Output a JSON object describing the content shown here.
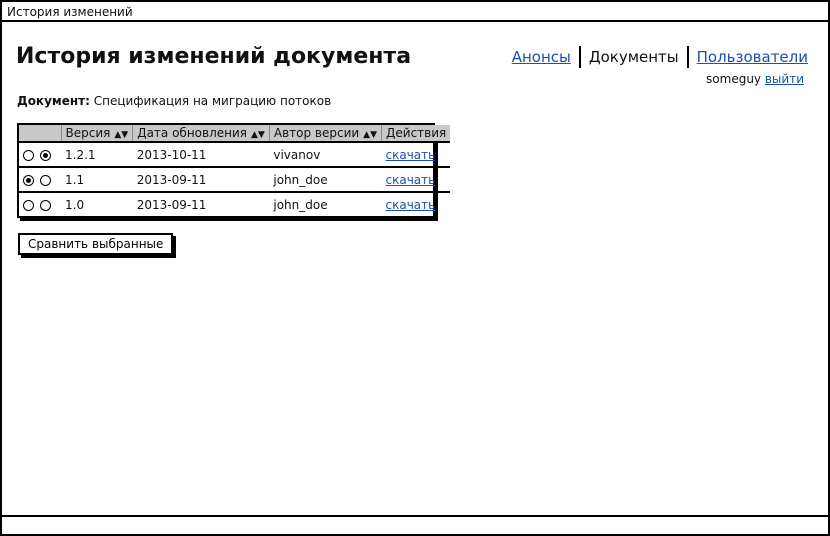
{
  "window": {
    "title": "История изменений"
  },
  "header": {
    "title": "История изменений документа",
    "nav": [
      {
        "label": "Анонсы",
        "current": false
      },
      {
        "label": "Документы",
        "current": true
      },
      {
        "label": "Пользователи",
        "current": false
      }
    ],
    "user": {
      "name": "someguy",
      "logout_label": "выйти"
    }
  },
  "document": {
    "label": "Документ:",
    "name": "Спецификация на миграцию потоков"
  },
  "table": {
    "columns": [
      "Версия",
      "Дата обновления",
      "Автор версии",
      "Действия"
    ],
    "rows": [
      {
        "version": "1.2.1",
        "date": "2013-10-11",
        "author": "vivanov",
        "action": "скачать",
        "radio_a": false,
        "radio_b": true
      },
      {
        "version": "1.1",
        "date": "2013-09-11",
        "author": "john_doe",
        "action": "скачать",
        "radio_a": true,
        "radio_b": false
      },
      {
        "version": "1.0",
        "date": "2013-09-11",
        "author": "john_doe",
        "action": "скачать",
        "radio_a": false,
        "radio_b": false
      }
    ]
  },
  "compare_button": {
    "label": "Сравнить выбранные"
  },
  "icons": {
    "sort": "sort-updown-icon"
  }
}
